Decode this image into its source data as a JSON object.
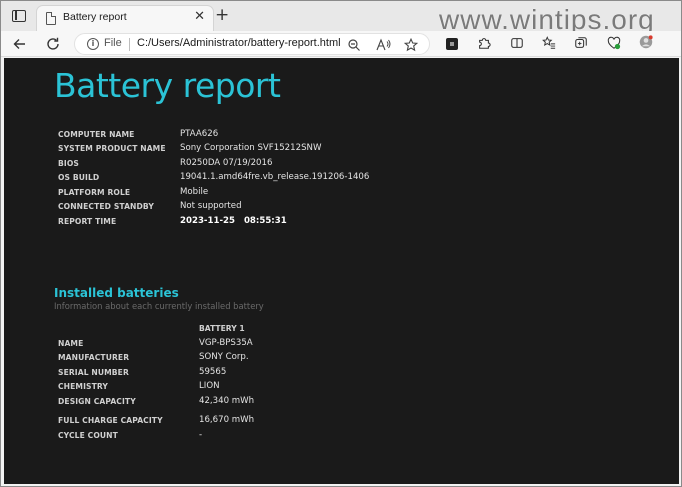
{
  "browser": {
    "tab_title": "Battery report",
    "tab_close": "✕",
    "new_tab": "+",
    "address_scheme": "File",
    "address_url": "C:/Users/Administrator/battery-report.html"
  },
  "watermark": "www.wintips.org",
  "report": {
    "title": "Battery report",
    "system_info": [
      {
        "label": "COMPUTER NAME",
        "value": "PTAA626"
      },
      {
        "label": "SYSTEM PRODUCT NAME",
        "value": "Sony Corporation SVF15212SNW"
      },
      {
        "label": "BIOS",
        "value": "R0250DA 07/19/2016"
      },
      {
        "label": "OS BUILD",
        "value": "19041.1.amd64fre.vb_release.191206-1406"
      },
      {
        "label": "PLATFORM ROLE",
        "value": "Mobile"
      },
      {
        "label": "CONNECTED STANDBY",
        "value": "Not supported"
      },
      {
        "label": "REPORT TIME",
        "value": "2023-11-25   08:55:31"
      }
    ],
    "installed_batteries": {
      "title": "Installed batteries",
      "subtitle": "Information about each currently installed battery",
      "column_header": "BATTERY 1",
      "rows": [
        {
          "label": "NAME",
          "value": "VGP-BPS35A"
        },
        {
          "label": "MANUFACTURER",
          "value": "SONY Corp."
        },
        {
          "label": "SERIAL NUMBER",
          "value": "59565"
        },
        {
          "label": "CHEMISTRY",
          "value": "LION"
        },
        {
          "label": "DESIGN CAPACITY",
          "value": "42,340 mWh"
        },
        {
          "label": "FULL CHARGE CAPACITY",
          "value": "16,670 mWh"
        },
        {
          "label": "CYCLE COUNT",
          "value": "-"
        }
      ]
    }
  },
  "colors": {
    "accent": "#2bc3d6",
    "page_background": "#1a1a1a",
    "text": "#e4e4e4"
  }
}
